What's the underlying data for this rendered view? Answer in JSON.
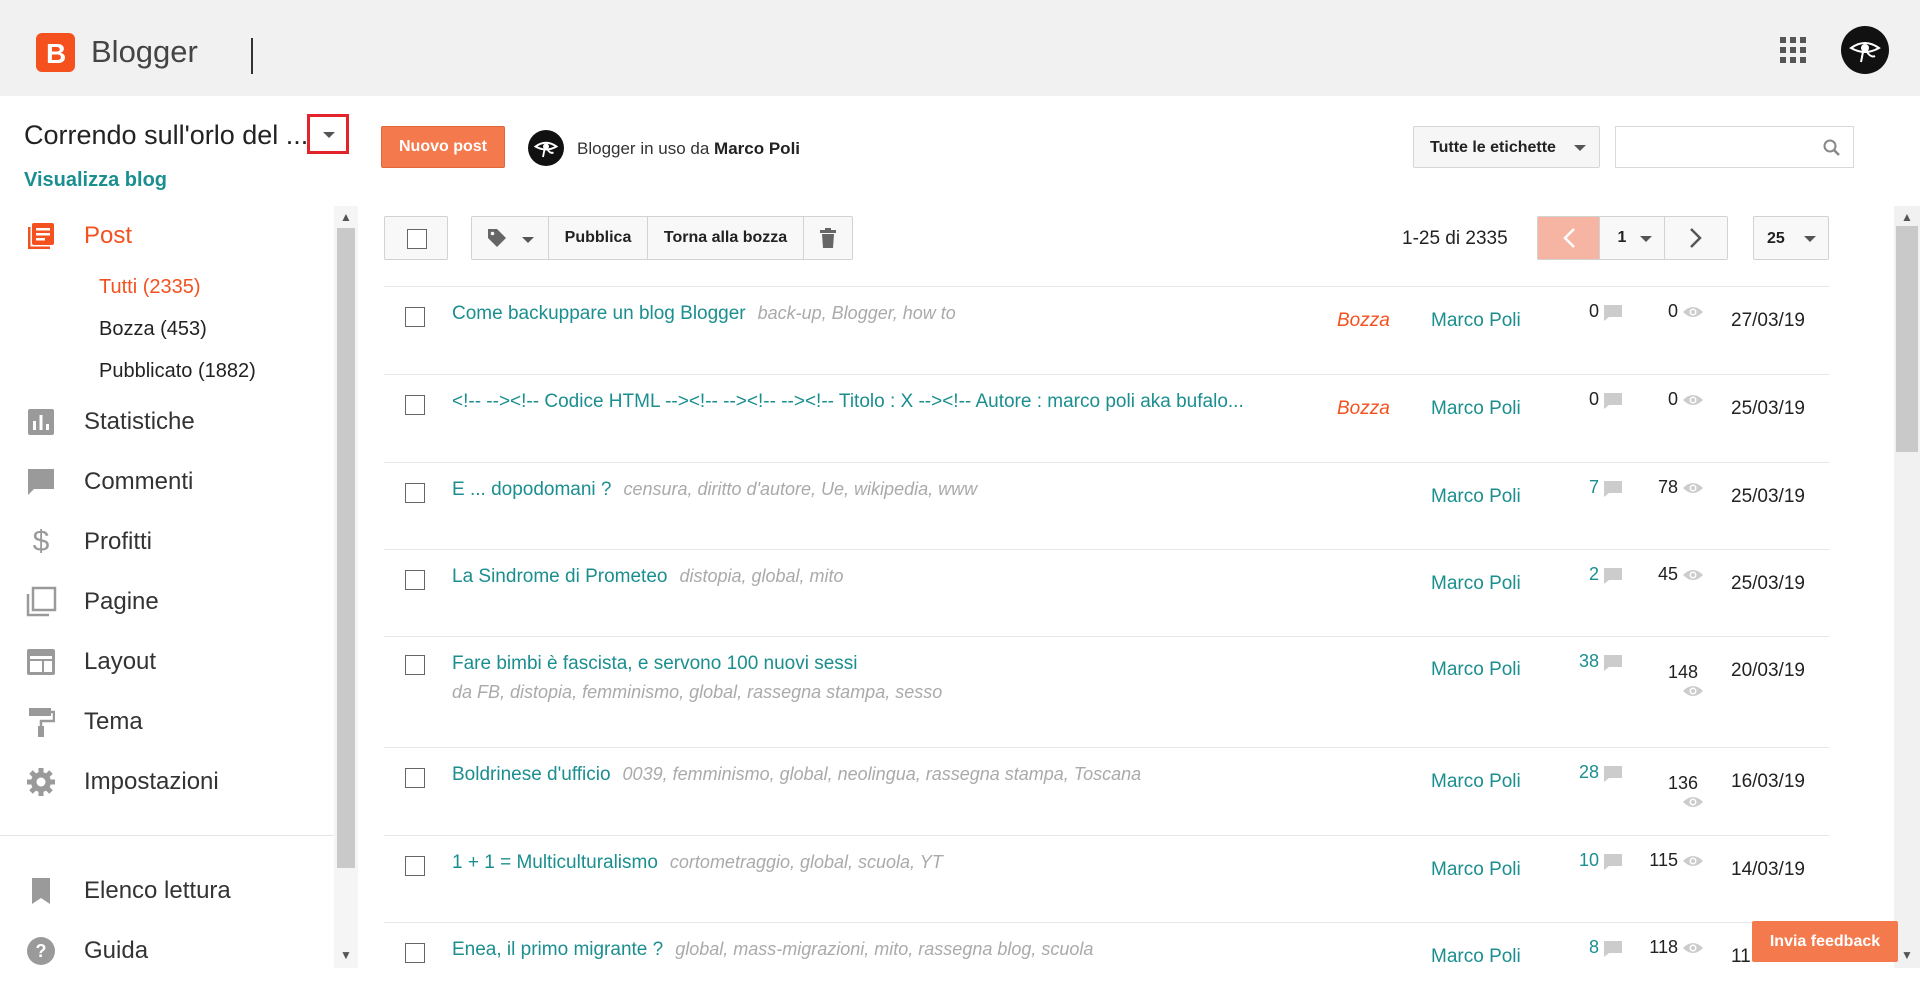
{
  "app": {
    "brand": "Blogger"
  },
  "sidebar": {
    "blog_title": "Correndo sull'orlo del ...",
    "view_blog": "Visualizza blog",
    "post_label": "Post",
    "sub_items": [
      {
        "label": "Tutti (2335)",
        "active": true
      },
      {
        "label": "Bozza (453)",
        "active": false
      },
      {
        "label": "Pubblicato (1882)",
        "active": false
      }
    ],
    "items": [
      {
        "label": "Statistiche",
        "icon": "stats-icon"
      },
      {
        "label": "Commenti",
        "icon": "comment-icon"
      },
      {
        "label": "Profitti",
        "icon": "dollar-icon"
      },
      {
        "label": "Pagine",
        "icon": "pages-icon"
      },
      {
        "label": "Layout",
        "icon": "layout-icon"
      },
      {
        "label": "Tema",
        "icon": "paint-roller-icon"
      },
      {
        "label": "Impostazioni",
        "icon": "gear-icon"
      }
    ],
    "reading_list": "Elenco lettura",
    "help": "Guida"
  },
  "header": {
    "new_post": "Nuovo post",
    "in_use_prefix": "Blogger in uso da ",
    "in_use_user": "Marco Poli",
    "labels_filter": "Tutte le etichette",
    "search_placeholder": ""
  },
  "toolbar": {
    "publish": "Pubblica",
    "revert_draft": "Torna alla bozza",
    "range": "1-25 di 2335",
    "page": "1",
    "per_page": "25"
  },
  "posts": [
    {
      "title": "Come backuppare un blog Blogger",
      "tags": "back-up, Blogger, how to",
      "tags_line": "",
      "status": "Bozza",
      "author": "Marco Poli",
      "comments": "0",
      "views": "0",
      "date": "27/03/19"
    },
    {
      "title": "<!-- --><!-- Codice HTML --><!-- --><!-- --><!-- Titolo : X --><!-- Autore : marco poli aka bufalo...",
      "tags": "",
      "tags_line": "",
      "status": "Bozza",
      "author": "Marco Poli",
      "comments": "0",
      "views": "0",
      "date": "25/03/19"
    },
    {
      "title": "E ... dopodomani ?",
      "tags": "censura, diritto d'autore, Ue, wikipedia, www",
      "tags_line": "",
      "status": "",
      "author": "Marco Poli",
      "comments": "7",
      "views": "78",
      "date": "25/03/19"
    },
    {
      "title": "La Sindrome di Prometeo",
      "tags": "distopia, global, mito",
      "tags_line": "",
      "status": "",
      "author": "Marco Poli",
      "comments": "2",
      "views": "45",
      "date": "25/03/19"
    },
    {
      "title": "Fare bimbi è fascista, e servono 100 nuovi sessi",
      "tags": "",
      "tags_line": "da FB, distopia, femminismo, global, rassegna stampa, sesso",
      "status": "",
      "author": "Marco Poli",
      "comments": "38",
      "views": "148",
      "date": "20/03/19"
    },
    {
      "title": "Boldrinese d'ufficio",
      "tags": "0039, femminismo, global, neolingua, rassegna stampa, Toscana",
      "tags_line": "",
      "status": "",
      "author": "Marco Poli",
      "comments": "28",
      "views": "136",
      "date": "16/03/19"
    },
    {
      "title": "1 + 1 = Multiculturalismo",
      "tags": "cortometraggio, global, scuola, YT",
      "tags_line": "",
      "status": "",
      "author": "Marco Poli",
      "comments": "10",
      "views": "115",
      "date": "14/03/19"
    },
    {
      "title": "Enea, il primo migrante ?",
      "tags": "global, mass-migrazioni, mito, rassegna blog, scuola",
      "tags_line": "",
      "status": "",
      "author": "Marco Poli",
      "comments": "8",
      "views": "118",
      "date": "11"
    }
  ],
  "feedback": "Invia feedback",
  "colors": {
    "accent": "#f4511e",
    "link": "#1b8e8f",
    "button": "#f4794d"
  }
}
